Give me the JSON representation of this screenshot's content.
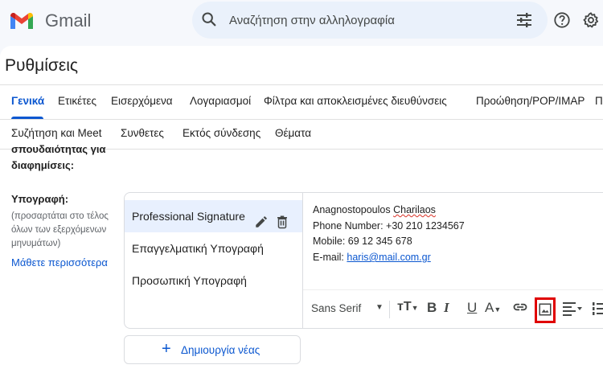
{
  "app": {
    "name": "Gmail"
  },
  "search": {
    "placeholder": "Αναζήτηση στην αλληλογραφία"
  },
  "page": {
    "title": "Ρυθμίσεις"
  },
  "tabs_row1": [
    "Γενικά",
    "Ετικέτες",
    "Εισερχόμενα",
    "Λογαριασμοί",
    "Φίλτρα και αποκλεισμένες διευθύνσεις",
    "Προώθηση/POP/IMAP",
    "Π"
  ],
  "tabs_row2": [
    "Συζήτηση και Meet",
    "Συνθετες",
    "Εκτός σύνδεσης",
    "Θέματα"
  ],
  "settings": {
    "cut_label_line1": "σπουδαιότητας για",
    "cut_label_line2": "διαφημίσεις:",
    "signature_label": "Υπογραφή:",
    "signature_desc_1": "(προσαρτάται στο τέλος",
    "signature_desc_2": "όλων των εξερχόμενων",
    "signature_desc_3": "μηνυμάτων)",
    "learn_more": "Μάθετε περισσότερα"
  },
  "signatures": [
    {
      "name": "Professional Signature",
      "selected": true
    },
    {
      "name": "Επαγγελματική Υπογραφή",
      "selected": false
    },
    {
      "name": "Προσωπική Υπογραφή",
      "selected": false
    }
  ],
  "signature_content": {
    "name_first": "Anagnostopoulos",
    "name_last": "Charilaos",
    "phone": "Phone Number: +30 210 1234567",
    "mobile": "Mobile: 69 12 345 678",
    "email_label": "E-mail:",
    "email": "haris@mail.com.gr"
  },
  "toolbar": {
    "font": "Sans Serif"
  },
  "create_button": {
    "label": "Δημιουργία νέας"
  },
  "colors": {
    "accent": "#0b57d0",
    "highlight": "#e00000",
    "selected_bg": "#e8f0fe"
  }
}
